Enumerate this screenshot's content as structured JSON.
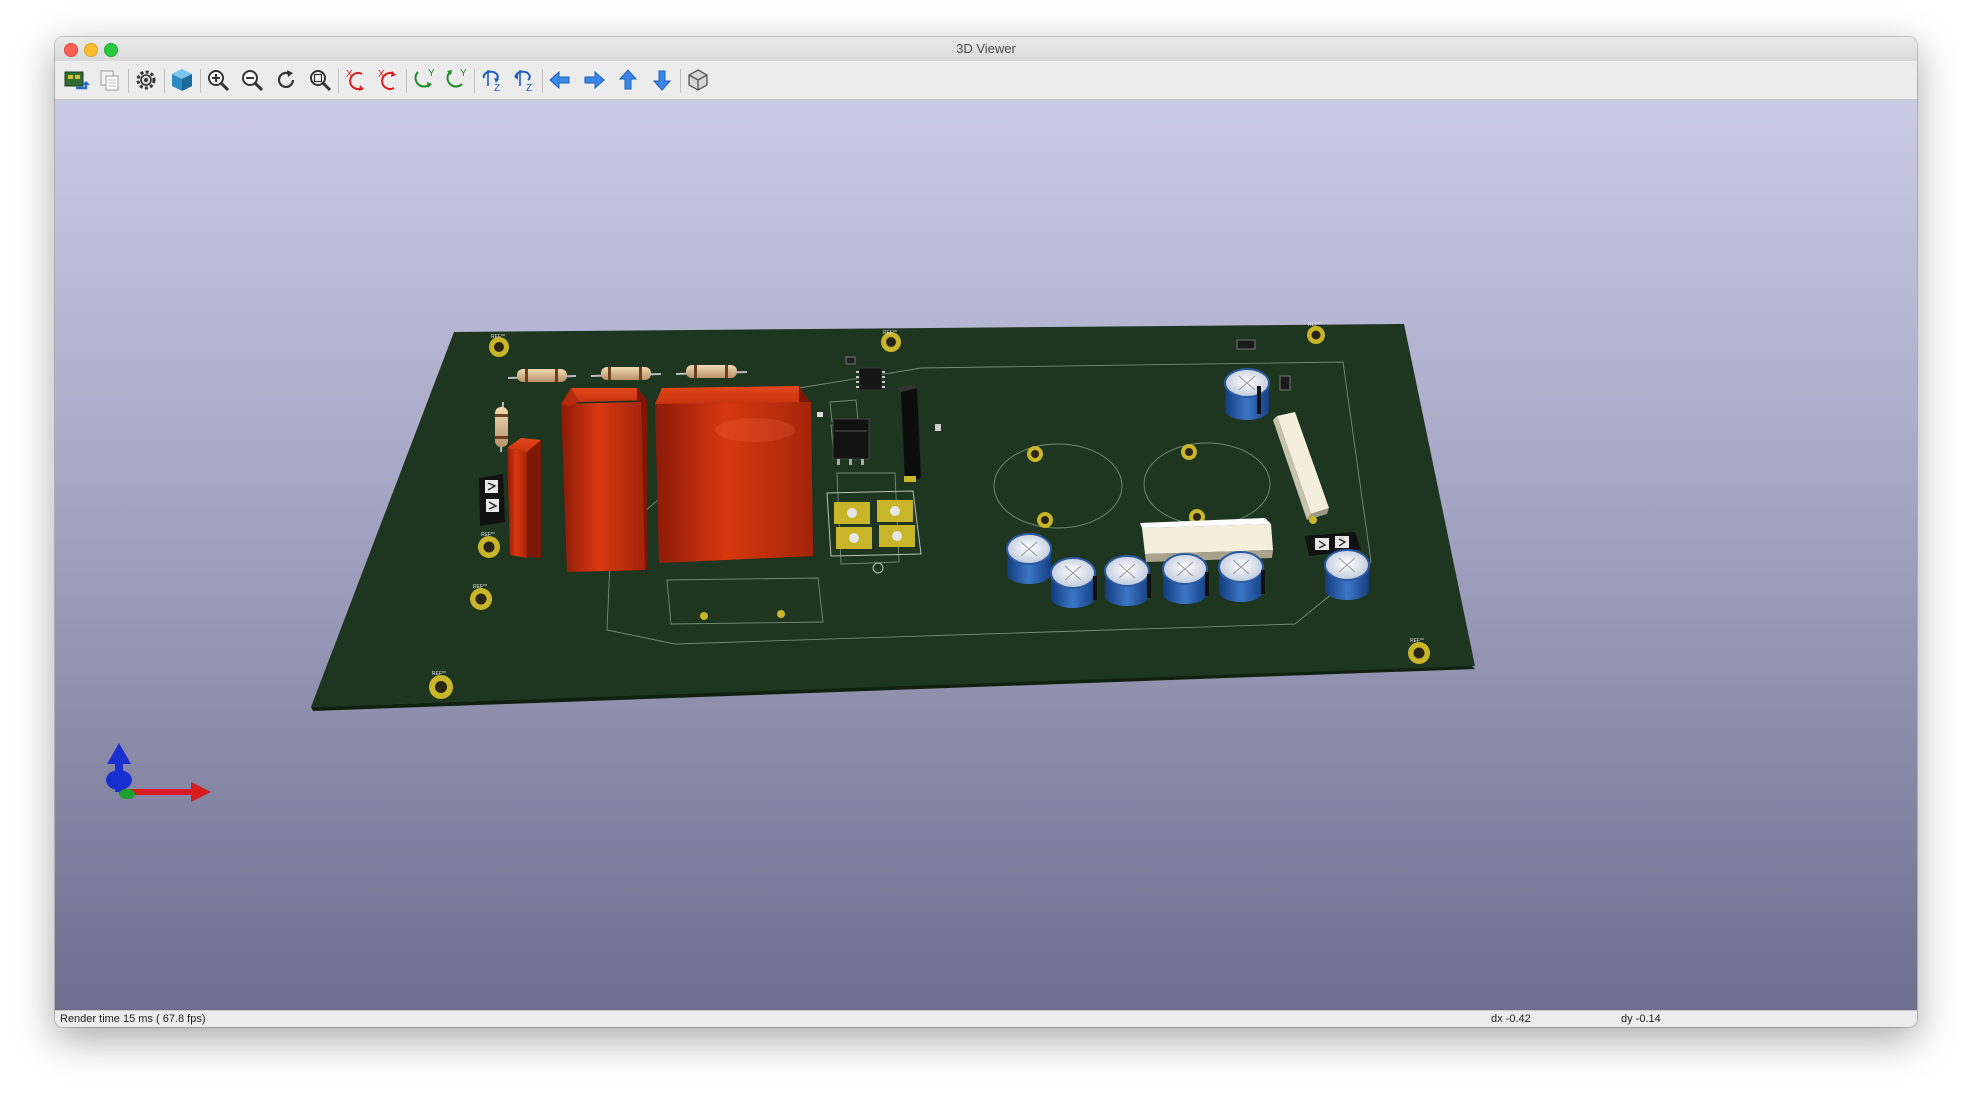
{
  "window": {
    "title": "3D Viewer"
  },
  "toolbar": {
    "buttons": [
      {
        "name": "reload-board-button",
        "icon": "reload-board-icon"
      },
      {
        "name": "copy-image-button",
        "icon": "copy-icon"
      },
      {
        "name": "preferences-button",
        "icon": "gear-icon"
      },
      {
        "name": "raytracing-button",
        "icon": "render-cube-icon"
      },
      {
        "name": "zoom-in-button",
        "icon": "zoom-in-icon"
      },
      {
        "name": "zoom-out-button",
        "icon": "zoom-out-icon"
      },
      {
        "name": "redraw-button",
        "icon": "refresh-icon"
      },
      {
        "name": "zoom-fit-button",
        "icon": "zoom-fit-icon"
      },
      {
        "name": "rotate-x-cw-button",
        "icon": "rotate-x-icon"
      },
      {
        "name": "rotate-x-ccw-button",
        "icon": "rotate-x-icon"
      },
      {
        "name": "rotate-y-cw-button",
        "icon": "rotate-y-icon"
      },
      {
        "name": "rotate-y-ccw-button",
        "icon": "rotate-y-icon"
      },
      {
        "name": "rotate-z-cw-button",
        "icon": "rotate-z-icon"
      },
      {
        "name": "rotate-z-ccw-button",
        "icon": "rotate-z-icon"
      },
      {
        "name": "pan-left-button",
        "icon": "arrow-left-icon"
      },
      {
        "name": "pan-right-button",
        "icon": "arrow-right-icon"
      },
      {
        "name": "pan-up-button",
        "icon": "arrow-up-icon"
      },
      {
        "name": "pan-down-button",
        "icon": "arrow-down-icon"
      },
      {
        "name": "ortho-view-button",
        "icon": "ortho-cube-icon"
      }
    ],
    "labels": {
      "x": "X",
      "y": "Y",
      "z": "Z"
    }
  },
  "scene": {
    "background_top": "#cacbe6",
    "background_bottom": "#6e6f8e",
    "board_color": "#1e3520",
    "silk_ref": "REF**"
  },
  "status": {
    "render_time": "Render time 15 ms ( 67.8 fps)",
    "dx": "dx -0.42",
    "dy": "dy -0.14"
  }
}
